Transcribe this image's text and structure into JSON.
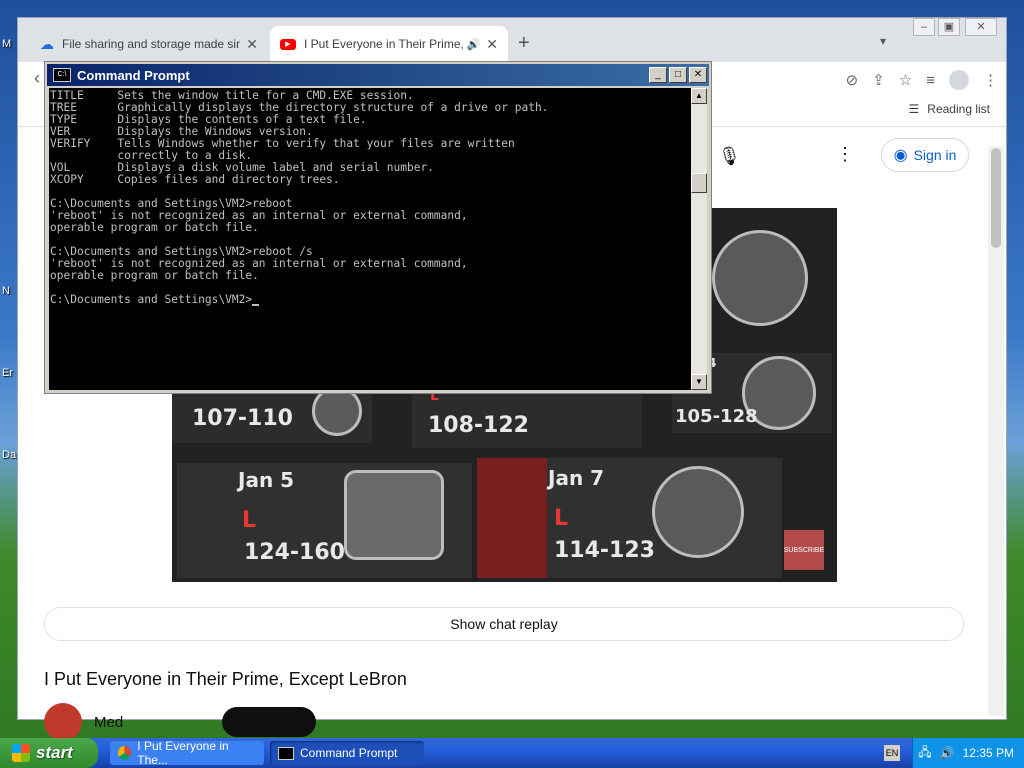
{
  "desktop": {
    "labels": [
      "M",
      "N",
      "Er",
      "Da"
    ]
  },
  "browser": {
    "tabs": [
      {
        "title": "File sharing and storage made simp",
        "icon": "cloud-icon"
      },
      {
        "title": "I Put Everyone in Their Prime, E",
        "icon": "youtube-icon",
        "audio_icon": "speaker-icon"
      }
    ],
    "new_tab": "+",
    "bookmarks": {
      "reading_list": "Reading list"
    },
    "youtube": {
      "sign_in": "Sign in",
      "video": {
        "scores": [
          {
            "score": "107-110"
          },
          {
            "score": "108-122"
          },
          {
            "score": "105-128"
          },
          {
            "date": "Jan 5",
            "result": "L",
            "score": "124-160"
          },
          {
            "date": "Jan 7",
            "result": "L",
            "score": "114-123"
          }
        ],
        "partial_l": "L",
        "partial_4": "4",
        "subscribe_badge": "SUBSCRIBE"
      },
      "show_chat_replay": "Show chat replay",
      "video_title": "I Put Everyone in Their Prime, Except LeBron",
      "channel_name": "Med"
    }
  },
  "cmd": {
    "title": "Command Prompt",
    "lines": [
      "TITLE     Sets the window title for a CMD.EXE session.",
      "TREE      Graphically displays the directory structure of a drive or path.",
      "TYPE      Displays the contents of a text file.",
      "VER       Displays the Windows version.",
      "VERIFY    Tells Windows whether to verify that your files are written",
      "          correctly to a disk.",
      "VOL       Displays a disk volume label and serial number.",
      "XCOPY     Copies files and directory trees.",
      "",
      "C:\\Documents and Settings\\VM2>reboot",
      "'reboot' is not recognized as an internal or external command,",
      "operable program or batch file.",
      "",
      "C:\\Documents and Settings\\VM2>reboot /s",
      "'reboot' is not recognized as an internal or external command,",
      "operable program or batch file.",
      "",
      "C:\\Documents and Settings\\VM2>"
    ]
  },
  "taskbar": {
    "start": "start",
    "items": [
      {
        "label": "I Put Everyone in The...",
        "icon": "chrome-icon"
      },
      {
        "label": "Command Prompt",
        "icon": "cmd-icon"
      }
    ],
    "clock": "12:35 PM"
  }
}
